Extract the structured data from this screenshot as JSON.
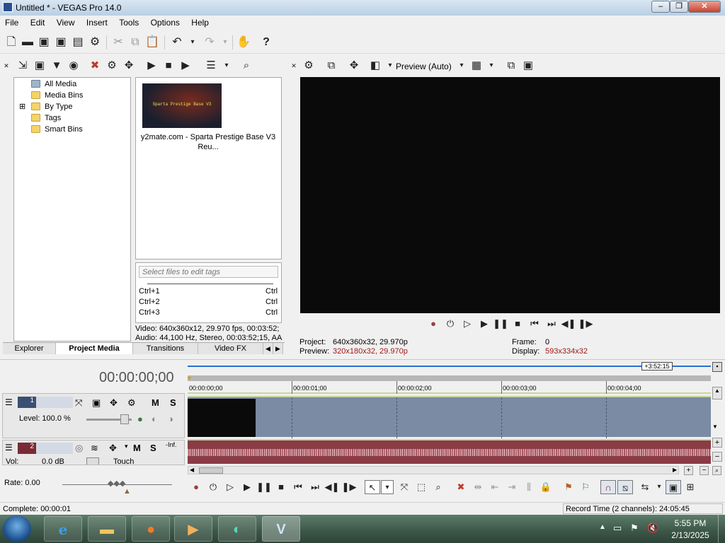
{
  "window": {
    "title": "Untitled * - VEGAS Pro 14.0",
    "minimize": "–",
    "maximize": "❐",
    "close": "✕"
  },
  "menu": [
    "File",
    "Edit",
    "View",
    "Insert",
    "Tools",
    "Options",
    "Help"
  ],
  "toolbar_icons": [
    "new-icon",
    "open-icon",
    "save-icon",
    "save-as-icon",
    "render-icon",
    "properties-icon",
    "cut-icon",
    "copy-icon",
    "paste-icon",
    "undo-icon",
    "redo-icon",
    "edit-tool-icon",
    "help-icon"
  ],
  "media_panel": {
    "tree": [
      "All Media",
      "Media Bins",
      "By Type",
      "Tags",
      "Smart Bins"
    ],
    "tree_expander": "⊞",
    "thumbnail_text": "Sparta Prestige Base V3",
    "media_label": "y2mate.com - Sparta Prestige Base V3 Reu...",
    "tags_placeholder": "Select files to edit tags",
    "shortcuts": [
      {
        "key": "Ctrl+1",
        "val": "Ctrl"
      },
      {
        "key": "Ctrl+2",
        "val": "Ctrl"
      },
      {
        "key": "Ctrl+3",
        "val": "Ctrl"
      }
    ],
    "video_info": "Video: 640x360x12, 29.970 fps, 00:03:52;",
    "audio_info": "Audio: 44,100 Hz, Stereo, 00:03:52;15, AA",
    "tabs": [
      "Explorer",
      "Project Media",
      "Transitions",
      "Video FX"
    ],
    "active_tab": "Project Media"
  },
  "preview": {
    "mode": "Preview (Auto)",
    "project_label": "Project:",
    "project_value": "640x360x32, 29.970p",
    "preview_label": "Preview:",
    "preview_value": "320x180x32, 29.970p",
    "frame_label": "Frame:",
    "frame_value": "0",
    "display_label": "Display:",
    "display_value": "593x334x32"
  },
  "timeline": {
    "timecode": "00:00:00;00",
    "end_marker": "+3:52:15",
    "ticks": [
      "00:00:00;00",
      "00:00:01;00",
      "00:00:02;00",
      "00:00:03;00",
      "00:00:04;00"
    ],
    "video_track": {
      "number": "1",
      "level": "Level: 100.0 %",
      "m": "M",
      "s": "S"
    },
    "audio_track": {
      "number": "2",
      "vol_label": "Vol:",
      "vol_value": "0.0 dB",
      "touch": "Touch",
      "m": "M",
      "s": "S",
      "inf": "-Inf."
    },
    "rate": "Rate: 0.00"
  },
  "status": {
    "complete": "Complete: 00:00:01",
    "record_time": "Record Time (2 channels): 24:05:45"
  },
  "taskbar": {
    "time": "5:55 PM",
    "date": "2/13/2025"
  },
  "colors": {
    "video_track": "#7a8ba3",
    "audio_track": "#8a3b45",
    "timeline_accent": "#2a6fd6"
  }
}
